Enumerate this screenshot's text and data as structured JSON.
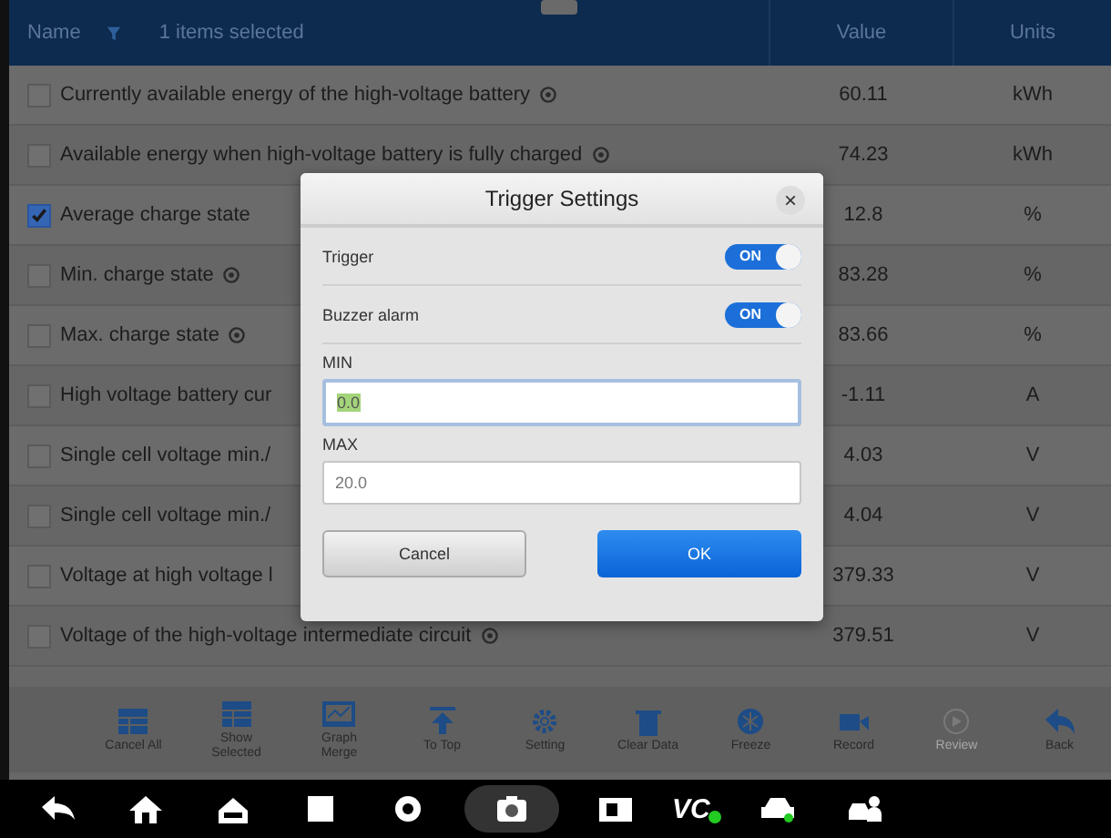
{
  "header": {
    "name": "Name",
    "selection": "1 items selected",
    "value": "Value",
    "units": "Units"
  },
  "rows": [
    {
      "name": "Currently available energy of the high-voltage battery",
      "has_icon": true,
      "checked": false,
      "value": "60.11",
      "unit": "kWh"
    },
    {
      "name": "Available energy when high-voltage battery is fully charged",
      "has_icon": true,
      "checked": false,
      "value": "74.23",
      "unit": "kWh"
    },
    {
      "name": "Average charge state",
      "has_icon": false,
      "checked": true,
      "value": "12.8",
      "unit": "%"
    },
    {
      "name": "Min. charge state",
      "has_icon": true,
      "checked": false,
      "value": "83.28",
      "unit": "%"
    },
    {
      "name": "Max. charge state",
      "has_icon": true,
      "checked": false,
      "value": "83.66",
      "unit": "%"
    },
    {
      "name": "High voltage battery cur",
      "has_icon": false,
      "checked": false,
      "value": "-1.11",
      "unit": "A"
    },
    {
      "name": "Single cell voltage min./",
      "has_icon": false,
      "checked": false,
      "value": "4.03",
      "unit": "V"
    },
    {
      "name": "Single cell voltage min./",
      "has_icon": false,
      "checked": false,
      "value": "4.04",
      "unit": "V"
    },
    {
      "name": "Voltage at high voltage l",
      "has_icon": false,
      "checked": false,
      "value": "379.33",
      "unit": "V"
    },
    {
      "name": "Voltage of the high-voltage intermediate circuit",
      "has_icon": true,
      "checked": false,
      "value": "379.51",
      "unit": "V"
    }
  ],
  "dialog": {
    "title": "Trigger Settings",
    "close": "×",
    "toggles": [
      {
        "label": "Trigger",
        "on": true,
        "text": "ON"
      },
      {
        "label": "Buzzer alarm",
        "on": true,
        "text": "ON"
      }
    ],
    "fields": [
      {
        "label": "MIN",
        "value": "0.0",
        "selected": true
      },
      {
        "label": "MAX",
        "value": "20.0",
        "selected": false
      }
    ],
    "buttons": [
      {
        "label": "Cancel",
        "kind": "secondary"
      },
      {
        "label": "OK",
        "kind": "primary"
      }
    ]
  },
  "toolbar": [
    {
      "label": "Cancel All",
      "kind": "table",
      "disabled": false
    },
    {
      "label": "Show Selected",
      "kind": "table",
      "disabled": false
    },
    {
      "label": "Graph Merge",
      "kind": "graph",
      "disabled": false
    },
    {
      "label": "To Top",
      "kind": "top",
      "disabled": false
    },
    {
      "label": "Setting",
      "kind": "gear",
      "disabled": false
    },
    {
      "label": "Clear Data",
      "kind": "trash",
      "disabled": false
    },
    {
      "label": "Freeze",
      "kind": "snow",
      "disabled": false
    },
    {
      "label": "Record",
      "kind": "video",
      "disabled": false
    },
    {
      "label": "Review",
      "kind": "play",
      "disabled": true
    },
    {
      "label": "Back",
      "kind": "back",
      "disabled": false
    }
  ],
  "navbar": [
    {
      "kind": "back"
    },
    {
      "kind": "home"
    },
    {
      "kind": "house"
    },
    {
      "kind": "square"
    },
    {
      "kind": "browser"
    },
    {
      "kind": "camera",
      "selected": true
    },
    {
      "kind": "record"
    },
    {
      "kind": "vci",
      "text": "VC"
    },
    {
      "kind": "car"
    },
    {
      "kind": "carperson"
    }
  ]
}
